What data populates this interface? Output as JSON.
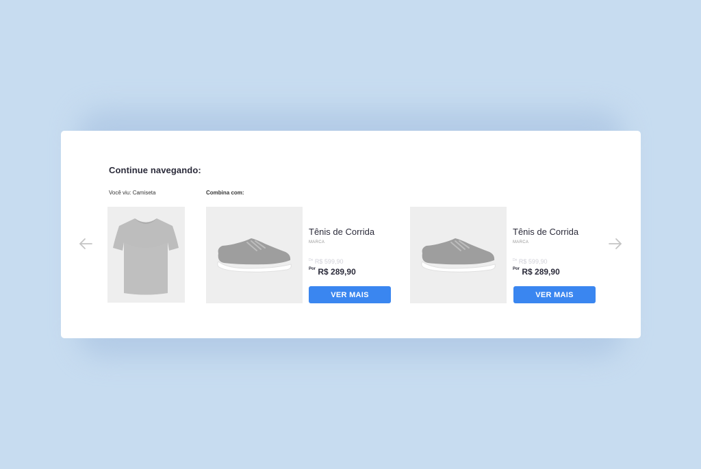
{
  "section": {
    "title": "Continue navegando:",
    "viewed_label": "Você viu: Camiseta",
    "combina_label": "Combina com:"
  },
  "viewed_product": {
    "icon": "tshirt-image"
  },
  "products": [
    {
      "name": "Tênis de Corrida",
      "brand": "MARCA",
      "old_price_label": "De",
      "old_price": "R$ 599,90",
      "new_price_label": "Por",
      "new_price": "R$ 289,90",
      "button_label": "VER MAIS",
      "icon": "sneaker-image"
    },
    {
      "name": "Tênis de Corrida",
      "brand": "MARCA",
      "old_price_label": "De",
      "old_price": "R$ 599,90",
      "new_price_label": "Por",
      "new_price": "R$ 289,90",
      "button_label": "VER MAIS",
      "icon": "sneaker-image"
    }
  ],
  "navigation": {
    "prev_icon": "arrow-left-icon",
    "next_icon": "arrow-right-icon"
  },
  "colors": {
    "background": "#c7dcf0",
    "card": "#ffffff",
    "accent": "#3a86f0",
    "image_bg": "#eeeeee"
  }
}
